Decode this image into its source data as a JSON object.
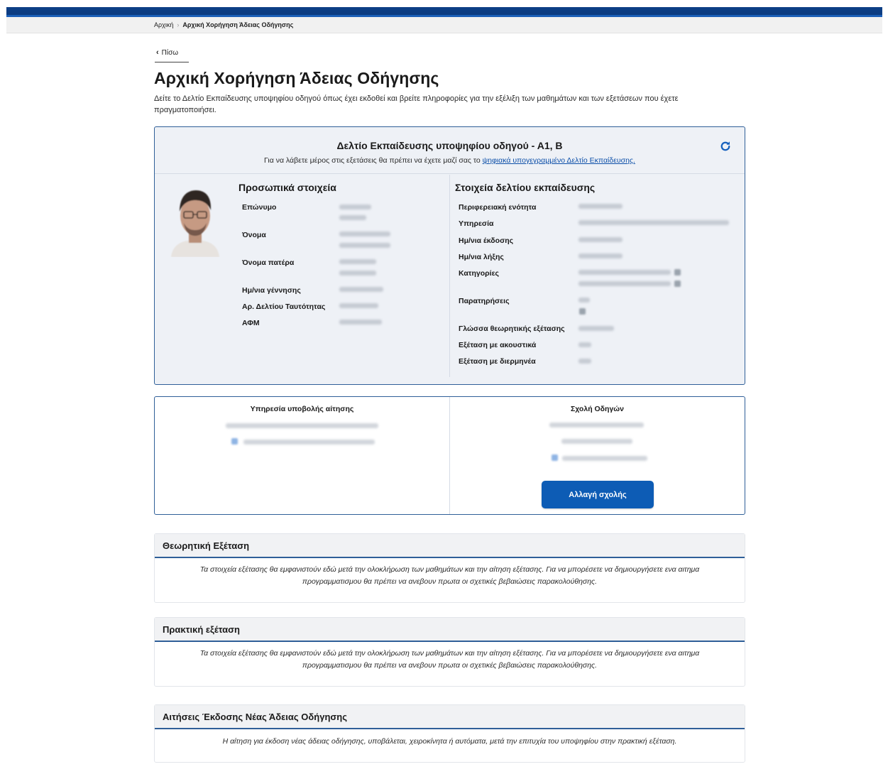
{
  "breadcrumb": {
    "home": "Αρχική",
    "current": "Αρχική Χορήγηση Άδειας Οδήγησης"
  },
  "back_label": "Πίσω",
  "page": {
    "title": "Αρχική Χορήγηση Άδειας Οδήγησης",
    "description": "Δείτε το Δελτίο Εκπαίδευσης υποψηφίου οδηγού όπως έχει εκδοθεί και βρείτε πληροφορίες για την εξέλιξη των μαθημάτων και των εξετάσεων που έχετε πραγματοποιήσει."
  },
  "card": {
    "title": "Δελτίο Εκπαίδευσης υποψηφίου οδηγού - Α1, Β",
    "subtitle_prefix": "Για να λάβετε μέρος στις εξετάσεις θα πρέπει να έχετε μαζί σας το ",
    "subtitle_link": "ψηφιακά υπογεγραμμένο Δελτίο Εκπαίδευσης.",
    "personal_title": "Προσωπικά στοιχεία",
    "personal_fields": [
      "Επώνυμο",
      "Όνομα",
      "Όνομα πατέρα",
      "Ημ/νια γέννησης",
      "Αρ. Δελτίου Ταυτότητας",
      "ΑΦΜ"
    ],
    "training_title": "Στοιχεία δελτίου εκπαίδευσης",
    "training_fields": [
      "Περιφερειακή ενότητα",
      "Υπηρεσία",
      "Ημ/νια έκδοσης",
      "Ημ/νια λήξης",
      "Κατηγορίες",
      "Παρατηρήσεις",
      "Γλώσσα θεωρητικής εξέτασης",
      "Εξέταση με ακουστικά",
      "Εξέταση με διερμηνέα"
    ]
  },
  "submission": {
    "service_title": "Υπηρεσία υποβολής αίτησης",
    "school_title": "Σχολή Οδηγών",
    "change_school_button": "Αλλαγή σχολής"
  },
  "theory": {
    "title": "Θεωρητική Εξέταση",
    "text": "Τα στοιχεία εξέτασης θα εμφανιστούν εδώ μετά την ολοκλήρωση των μαθημάτων και την αίτηση εξέτασης. Για να μπορέσετε να δημιουργήσετε ενα αιτημα προγραμματισμου θα πρέπει να ανεβουν πρωτα οι σχετικές βεβαιώσεις παρακολούθησης."
  },
  "practical": {
    "title": "Πρακτική εξέταση",
    "text": "Τα στοιχεία εξέτασης θα εμφανιστούν εδώ μετά την ολοκλήρωση των μαθημάτων και την αίτηση εξέτασης. Για να μπορέσετε να δημιουργήσετε ενα αιτημα προγραμματισμου θα πρέπει να ανεβουν πρωτα οι σχετικές βεβαιώσεις παρακολούθησης."
  },
  "new_license": {
    "title": "Αιτήσεις Έκδοσης Νέας Άδειας Οδήγησης",
    "text": "Η αίτηση για έκδοση νέας άδειας οδήγησης, υποβάλεται, χειροκίνητα ή αυτόματα, μετά την επιτυχία του υποψηφίου στην πρακτική εξέταση."
  },
  "colors": {
    "header": "#0d3f86",
    "primary": "#0d5cb5",
    "card_bg": "#eef1f6",
    "border": "#2f5f98"
  },
  "icons": {
    "refresh": "refresh-icon",
    "back": "chevron-left-icon",
    "breadcrumb_sep": "chevron-right-icon"
  }
}
